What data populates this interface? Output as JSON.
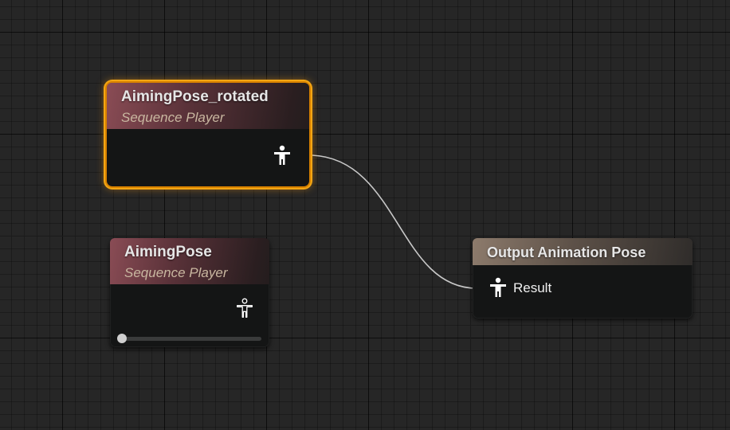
{
  "graph": {
    "nodes": [
      {
        "title": "AimingPose_rotated",
        "subtitle": "Sequence Player",
        "selected": true,
        "output_pin": "pose-connected-icon"
      },
      {
        "title": "AimingPose",
        "subtitle": "Sequence Player",
        "selected": false,
        "output_pin": "pose-disconnected-icon",
        "position_slider": 0
      },
      {
        "title": "Output Animation Pose",
        "input_pin_label": "Result",
        "input_pin": "pose-connected-icon"
      }
    ],
    "wire_color": "#c8c8c8",
    "selection_color": "#f3a613"
  }
}
